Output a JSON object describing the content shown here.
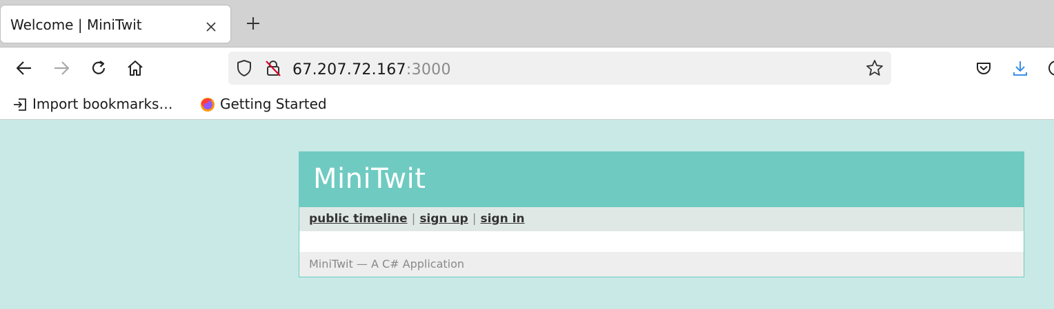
{
  "browser": {
    "tab": {
      "title": "Welcome | MiniTwit"
    },
    "url": {
      "host": "67.207.72.167",
      "port": ":3000"
    },
    "bookmarks": [
      {
        "label": "Import bookmarks…"
      },
      {
        "label": "Getting Started"
      }
    ]
  },
  "page": {
    "title": "MiniTwit",
    "nav": {
      "public_timeline": "public timeline",
      "sign_up": "sign up",
      "sign_in": "sign in",
      "separator": "|"
    },
    "footer": "MiniTwit — A C# Application"
  },
  "colors": {
    "page_background": "#c8e9e6",
    "header_background": "#6fcbc1",
    "nav_background": "#e0e8e6",
    "footer_background": "#eeeeee"
  }
}
